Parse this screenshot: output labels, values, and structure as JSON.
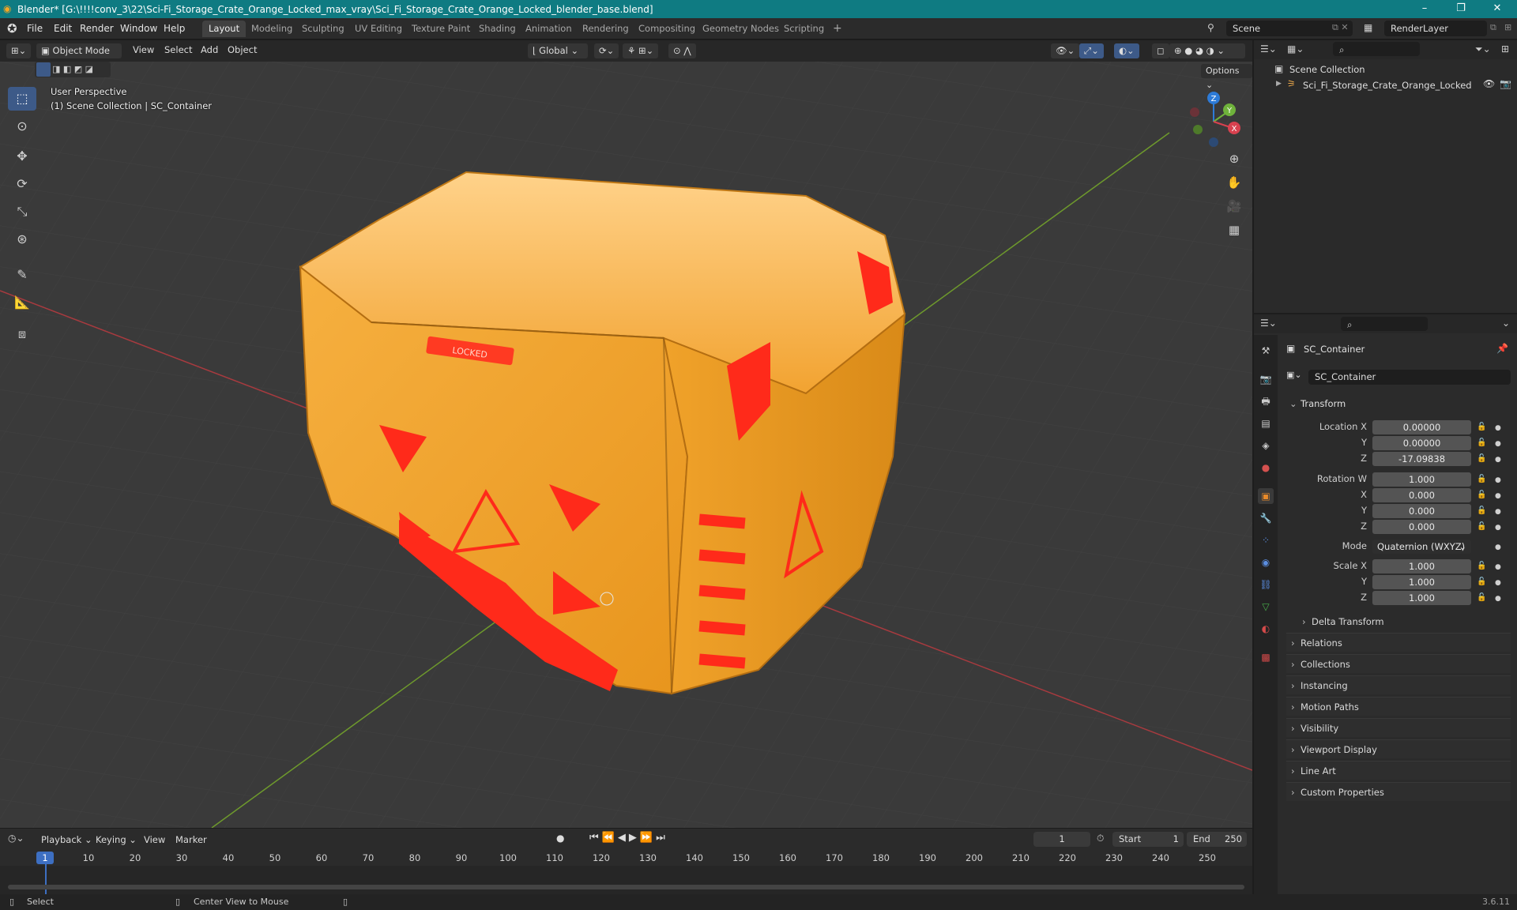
{
  "window": {
    "title": "Blender* [G:\\!!!!conv_3\\22\\Sci-Fi_Storage_Crate_Orange_Locked_max_vray\\Sci_Fi_Storage_Crate_Orange_Locked_blender_base.blend]",
    "minimize": "–",
    "maximize": "❐",
    "close": "✕"
  },
  "menubar": [
    "File",
    "Edit",
    "Render",
    "Window",
    "Help"
  ],
  "workspaces": [
    "Layout",
    "Modeling",
    "Sculpting",
    "UV Editing",
    "Texture Paint",
    "Shading",
    "Animation",
    "Rendering",
    "Compositing",
    "Geometry Nodes",
    "Scripting"
  ],
  "active_workspace": "Layout",
  "add_workspace": "+",
  "scene": "Scene",
  "view_layer": "RenderLayer",
  "viewport_header": {
    "mode": "Object Mode",
    "menus": [
      "View",
      "Select",
      "Add",
      "Object"
    ],
    "orientation": "Global",
    "options": "Options"
  },
  "viewport": {
    "perspective": "User Perspective",
    "collection_info": "(1) Scene Collection | SC_Container",
    "gizmo": {
      "z": "Z",
      "y": "Y",
      "x": "X"
    }
  },
  "outliner": {
    "root": "Scene Collection",
    "items": [
      {
        "label": "Sci_Fi_Storage_Crate_Orange_Locked"
      }
    ]
  },
  "properties": {
    "object_name": "SC_Container",
    "data_name": "SC_Container",
    "transform": {
      "header": "Transform",
      "location_label": "Location X",
      "location": [
        "0.00000",
        "0.00000",
        "-17.09838"
      ],
      "rotation_label": "Rotation W",
      "rotation": [
        "1.000",
        "0.000",
        "0.000",
        "0.000"
      ],
      "axis_labels": [
        "X",
        "Y",
        "Z"
      ],
      "mode_label": "Mode",
      "mode": "Quaternion (WXYZ)",
      "scale_label": "Scale X",
      "scale": [
        "1.000",
        "1.000",
        "1.000"
      ],
      "delta": "Delta Transform"
    },
    "panels": [
      "Relations",
      "Collections",
      "Instancing",
      "Motion Paths",
      "Visibility",
      "Viewport Display",
      "Line Art",
      "Custom Properties"
    ]
  },
  "timeline": {
    "menus": [
      "Playback",
      "Keying",
      "View",
      "Marker"
    ],
    "current_frame": "1",
    "start_label": "Start",
    "start": "1",
    "end_label": "End",
    "end": "250",
    "ticks": [
      "1",
      "10",
      "20",
      "30",
      "40",
      "50",
      "60",
      "70",
      "80",
      "90",
      "100",
      "110",
      "120",
      "130",
      "140",
      "150",
      "160",
      "170",
      "180",
      "190",
      "200",
      "210",
      "220",
      "230",
      "240",
      "250"
    ]
  },
  "statusbar": {
    "select": "Select",
    "center": "Center View to Mouse",
    "version": "3.6.11"
  },
  "crate_label": "LOCKED",
  "colors": {
    "accent": "#3d5a88",
    "crate": "#f0a020",
    "crate_red": "#ff2a1a",
    "titlebar": "#0f7b82"
  }
}
